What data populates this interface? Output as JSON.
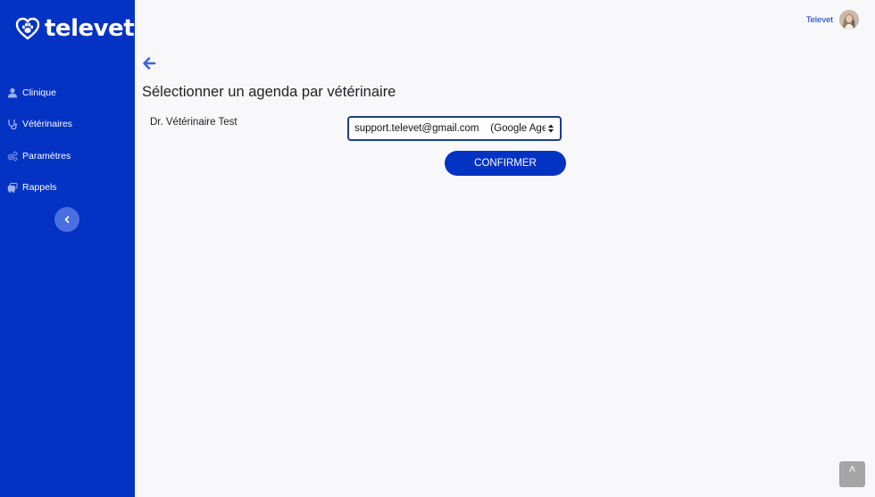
{
  "brand": {
    "name": "televet",
    "color": "#0433c3",
    "logo_icon": "heart-paw-icon"
  },
  "sidebar": {
    "items": [
      {
        "label": "Clinique",
        "icon": "user-icon"
      },
      {
        "label": "Vétérinaires",
        "icon": "stethoscope-icon"
      },
      {
        "label": "Paramètres",
        "icon": "gears-icon"
      },
      {
        "label": "Rappels",
        "icon": "reminder-icon"
      }
    ],
    "collapse_icon": "chevron-left-icon"
  },
  "header": {
    "username": "Televet",
    "avatar": "avatar"
  },
  "main": {
    "back_icon": "arrow-left-icon",
    "title": "Sélectionner un agenda par vétérinaire",
    "rows": [
      {
        "vet_name": "Dr. Vétérinaire Test",
        "selected_agenda": "support.televet@gmail.com    (Google Agenda)"
      }
    ],
    "confirm_label": "CONFIRMER"
  },
  "scroll_top": {
    "glyph": "˄"
  }
}
